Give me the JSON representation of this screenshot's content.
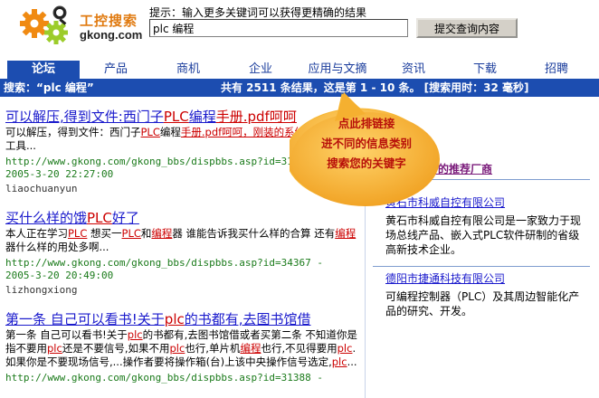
{
  "header": {
    "logo_cn": "工控搜索",
    "logo_en": "gkong.com",
    "hint": "提示：输入更多关键词可以获得更精确的结果",
    "search_value": "plc 编程",
    "submit_label": "提交查询内容"
  },
  "nav": {
    "tabs": [
      {
        "label": "论坛",
        "active": true
      },
      {
        "label": "产品",
        "active": false
      },
      {
        "label": "商机",
        "active": false
      },
      {
        "label": "企业",
        "active": false
      },
      {
        "label": "应用与文摘",
        "active": false
      },
      {
        "label": "资讯",
        "active": false
      },
      {
        "label": "下载",
        "active": false
      },
      {
        "label": "招聘",
        "active": false
      }
    ]
  },
  "status": {
    "query_prefix": "搜索：“plc 编程”",
    "summary": "共有 2511 条结果，这是第 1 - 10 条。 [搜索用时：32 毫秒]"
  },
  "results": [
    {
      "title_parts": [
        "可以解压,得到文件:西门子",
        "PLC",
        "编程",
        "手册.pdf呵呵"
      ],
      "snippet_parts": [
        "可以解压，得到文件：西门子",
        "PLC",
        "编程",
        "手册.pdf呵呵，刚装的系统，正在装新",
        "工具..."
      ],
      "url": "http://www.gkong.com/gkong_bbs/dispbbs.asp?id=31920 -",
      "date": "2005-3-20 22:27:00",
      "user": "liaochuanyun"
    },
    {
      "title_parts": [
        "买什么样的饿",
        "PLC",
        "好了"
      ],
      "snippet_parts": [
        "本人正在学习",
        "PLC",
        " 想买一",
        "PLC",
        "和",
        "编程",
        "器 谁能告诉我买什么样的合算 还有",
        "编程",
        "器什么样的用处多啊..."
      ],
      "url": "http://www.gkong.com/gkong_bbs/dispbbs.asp?id=34367 -",
      "date": "2005-3-20 20:49:00",
      "user": "lizhongxiong"
    },
    {
      "title_parts": [
        "第一条 自己可以看书!关于",
        "plc",
        "的书都有,去图书馆借"
      ],
      "snippet_parts": [
        "第一条 自己可以看书!关于",
        "plc",
        "的书都有,去图书馆借或者买第二条 不知道你是指不要用",
        "plc",
        "还是不要信号,如果不用",
        "plc",
        "也行,单片机",
        "编程",
        "也行,不见得要用",
        "plc",
        ". 如果你是不要现场信号,...操作者要将操作箱(台)上该中央操作信号选定,",
        "plc",
        "..."
      ],
      "url": "http://www.gkong.com/gkong_bbs/dispbbs.asp?id=31388 -",
      "date": "",
      "user": ""
    }
  ],
  "sidebar": {
    "title": "成为此关键字的推荐厂商",
    "vendors": [
      {
        "name": "黄石市科威自控有限公司",
        "desc": "黄石市科威自控有限公司是一家致力于现场总线产品、嵌入式PLC软件研制的省级高新技术企业。"
      },
      {
        "name": "德阳市捷通科技有限公司",
        "desc": "可编程控制器（PLC）及其周边智能化产品的研究、开发。"
      }
    ]
  },
  "callout": {
    "lines": [
      "点此排链接",
      "进不同的信息类别",
      "搜索您的关键字"
    ]
  },
  "colors": {
    "nav_blue": "#1c4db0",
    "callout_orange": "#f5a623",
    "highlight_red": "#cc0000",
    "link_blue": "#1a1acc",
    "url_green": "#1a7a1a"
  }
}
